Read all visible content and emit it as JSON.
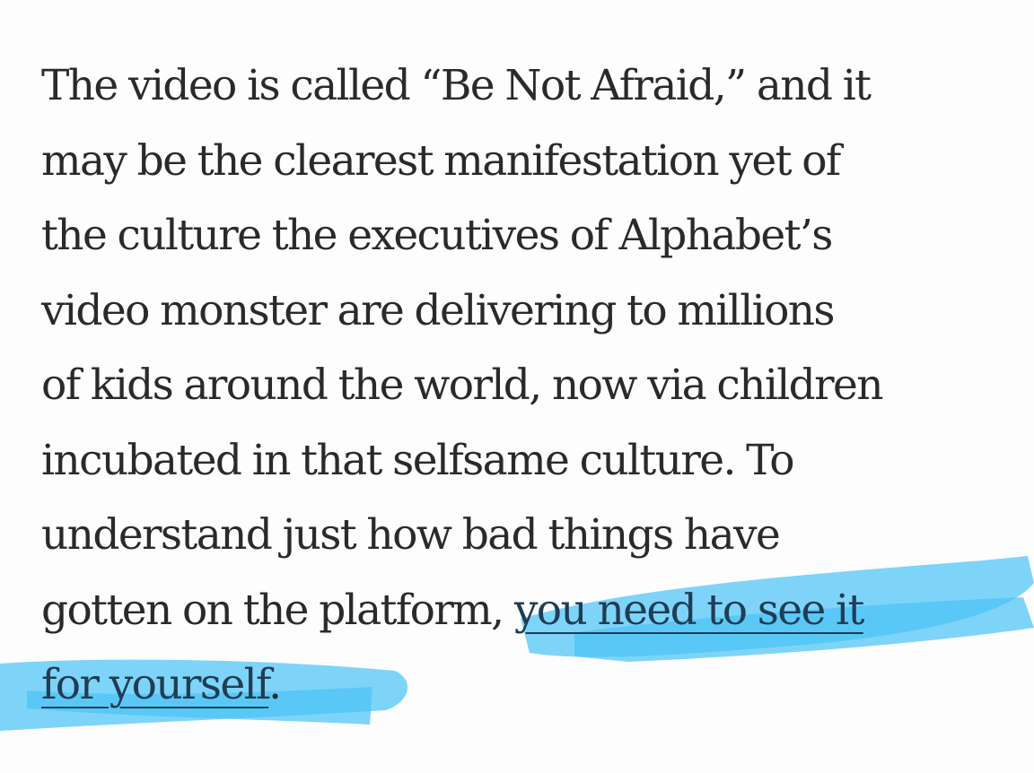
{
  "article": {
    "lines": [
      "The video is called “Be Not Afraid,” and it",
      "may be the clearest manifestation yet of",
      "the culture the executives of Alphabet’s",
      "video monster are delivering to millions",
      "of kids around the world, now via children",
      "incubated in that selfsame culture. To",
      "understand just how bad things have"
    ],
    "line8_prefix": "gotten on the platform, ",
    "link_part1": "you need to see it",
    "link_part2": "for yourself",
    "line9_suffix": "."
  },
  "highlight": {
    "color": "#4cc3f5"
  }
}
